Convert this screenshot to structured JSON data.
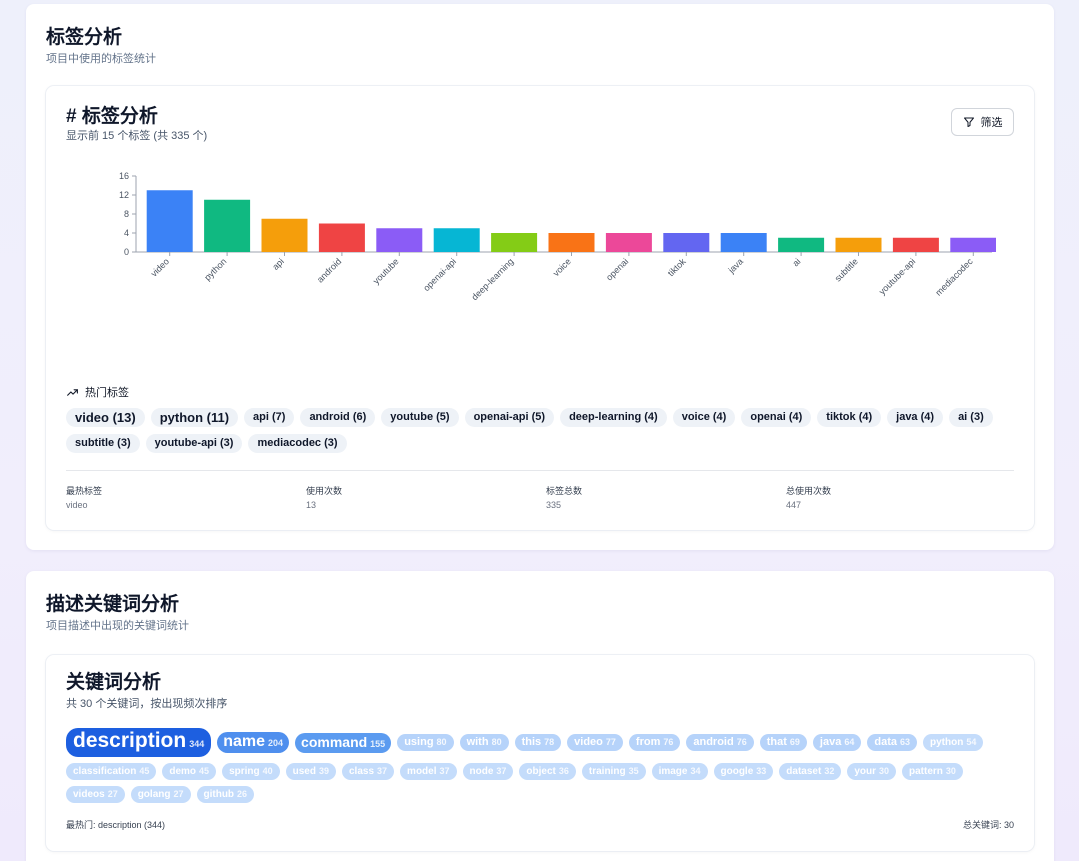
{
  "tags_section": {
    "title": "标签分析",
    "subtitle": "项目中使用的标签统计"
  },
  "tags_card": {
    "hash": "#",
    "title": "标签分析",
    "subtitle": "显示前 15 个标签 (共 335 个)",
    "filter_label": "筛选",
    "hot_label": "热门标签",
    "chips": [
      "video (13)",
      "python (11)",
      "api (7)",
      "android (6)",
      "youtube (5)",
      "openai-api (5)",
      "deep-learning (4)",
      "voice (4)",
      "openai (4)",
      "tiktok (4)",
      "java (4)",
      "ai (3)",
      "subtitle (3)",
      "youtube-api (3)",
      "mediacodec (3)"
    ],
    "stats": [
      {
        "label": "最热标签",
        "value": "video"
      },
      {
        "label": "使用次数",
        "value": "13"
      },
      {
        "label": "标签总数",
        "value": "335"
      },
      {
        "label": "总使用次数",
        "value": "447"
      }
    ]
  },
  "chart_data": {
    "type": "bar",
    "categories": [
      "video",
      "python",
      "api",
      "android",
      "youtube",
      "openai-api",
      "deep-learning",
      "voice",
      "openai",
      "tiktok",
      "java",
      "ai",
      "subtitle",
      "youtube-api",
      "mediacodec"
    ],
    "values": [
      13,
      11,
      7,
      6,
      5,
      5,
      4,
      4,
      4,
      4,
      4,
      3,
      3,
      3,
      3
    ],
    "colors": [
      "#3b82f6",
      "#10b981",
      "#f59e0b",
      "#ef4444",
      "#8b5cf6",
      "#06b6d4",
      "#84cc16",
      "#f97316",
      "#ec4899",
      "#6366f1",
      "#3b82f6",
      "#10b981",
      "#f59e0b",
      "#ef4444",
      "#8b5cf6"
    ],
    "yticks": [
      0,
      4,
      8,
      12,
      16
    ],
    "ylim": [
      0,
      16
    ],
    "title": "",
    "xlabel": "",
    "ylabel": ""
  },
  "kw_section": {
    "title": "描述关键词分析",
    "subtitle": "项目描述中出现的关键词统计"
  },
  "kw_card": {
    "title": "关键词分析",
    "subtitle": "共 30 个关键词，按出现频次排序",
    "keywords": [
      {
        "word": "description",
        "count": "344",
        "level": 1
      },
      {
        "word": "name",
        "count": "204",
        "level": 2
      },
      {
        "word": "command",
        "count": "155",
        "level": 3
      },
      {
        "word": "using",
        "count": "80",
        "level": 4
      },
      {
        "word": "with",
        "count": "80",
        "level": 4
      },
      {
        "word": "this",
        "count": "78",
        "level": 4
      },
      {
        "word": "video",
        "count": "77",
        "level": 4
      },
      {
        "word": "from",
        "count": "76",
        "level": 4
      },
      {
        "word": "android",
        "count": "76",
        "level": 4
      },
      {
        "word": "that",
        "count": "69",
        "level": 4
      },
      {
        "word": "java",
        "count": "64",
        "level": 4
      },
      {
        "word": "data",
        "count": "63",
        "level": 4
      },
      {
        "word": "python",
        "count": "54",
        "level": 5
      },
      {
        "word": "classification",
        "count": "45",
        "level": 5
      },
      {
        "word": "demo",
        "count": "45",
        "level": 5
      },
      {
        "word": "spring",
        "count": "40",
        "level": 5
      },
      {
        "word": "used",
        "count": "39",
        "level": 5
      },
      {
        "word": "class",
        "count": "37",
        "level": 5
      },
      {
        "word": "model",
        "count": "37",
        "level": 5
      },
      {
        "word": "node",
        "count": "37",
        "level": 5
      },
      {
        "word": "object",
        "count": "36",
        "level": 5
      },
      {
        "word": "training",
        "count": "35",
        "level": 5
      },
      {
        "word": "image",
        "count": "34",
        "level": 5
      },
      {
        "word": "google",
        "count": "33",
        "level": 5
      },
      {
        "word": "dataset",
        "count": "32",
        "level": 5
      },
      {
        "word": "your",
        "count": "30",
        "level": 5
      },
      {
        "word": "pattern",
        "count": "30",
        "level": 5
      },
      {
        "word": "videos",
        "count": "27",
        "level": 5
      },
      {
        "word": "golang",
        "count": "27",
        "level": 5
      },
      {
        "word": "github",
        "count": "26",
        "level": 5
      }
    ],
    "footer_left": "最热门: description (344)",
    "footer_right": "总关键词: 30"
  },
  "colors": {
    "kw_level1": "#1d5fe0",
    "kw_level2": "#4f8fee",
    "kw_level3": "#5b9bf0",
    "kw_level4": "#b6d3fa",
    "kw_level5": "#c4dcfb"
  }
}
